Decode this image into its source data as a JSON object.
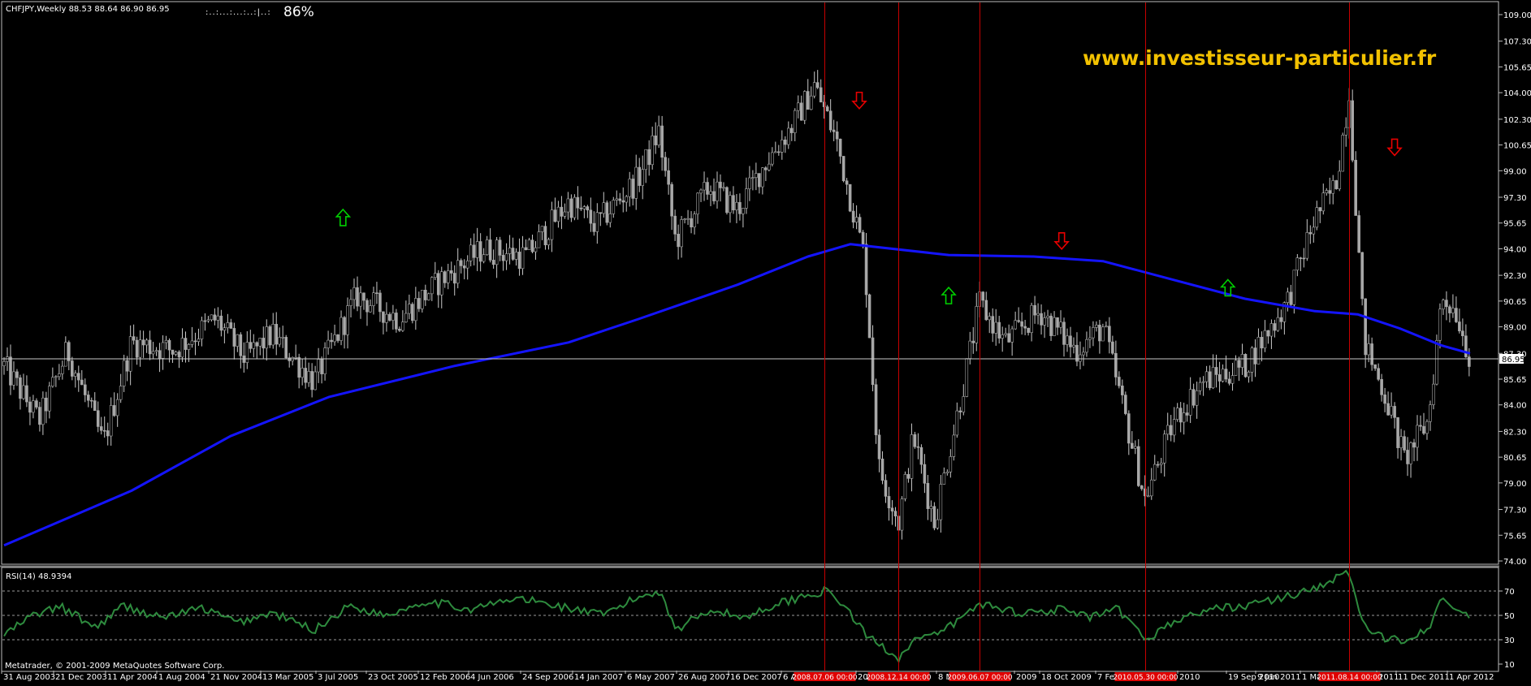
{
  "header": {
    "symbol_info": "CHFJPY,Weekly  88.53 88.64 86.90 86.95",
    "indicator_dots": ":..:...:...:..:|..:",
    "indicator_pct": "86%"
  },
  "watermark": "www.investisseur-particulier.fr",
  "rsi_panel": {
    "label": "RSI(14) 48.9394",
    "copyright": "Metatrader, © 2001-2009 MetaQuotes Software Corp."
  },
  "colors": {
    "background": "#000000",
    "candle_body": "#a8a8a8",
    "moving_average": "#1414ff",
    "vertical_markers": "#c80000",
    "rsi_line": "#2e8b3e",
    "up_arrow": "#00d000",
    "down_arrow": "#e80000",
    "watermark": "#f2c100"
  },
  "chart_data": [
    {
      "type": "candlestick",
      "symbol": "CHFJPY",
      "timeframe": "Weekly",
      "ylim": [
        74.0,
        109.0
      ],
      "y_ticks": [
        "109.00",
        "107.30",
        "105.65",
        "104.00",
        "102.30",
        "100.65",
        "99.00",
        "97.30",
        "95.65",
        "94.00",
        "92.30",
        "90.65",
        "89.00",
        "87.30",
        "85.65",
        "84.00",
        "82.30",
        "80.65",
        "79.00",
        "77.30",
        "75.65",
        "74.00"
      ],
      "current_price": "86.95",
      "x_tick_labels": [
        "31 Aug 2003",
        "21 Dec 2003",
        "11 Apr 2004",
        "1 Aug 2004",
        "21 Nov 2004",
        "13 Mar 2005",
        "3 Jul 2005",
        "23 Oct 2005",
        "12 Feb 2006",
        "4 Jun 2006",
        "24 Sep 2006",
        "14 Jan 2007",
        "6 May 2007",
        "26 Aug 2007",
        "16 Dec 2007",
        "6 A",
        "200",
        "8 M",
        "2009",
        "18 Oct 2009",
        "7 Feb",
        "2010",
        "19 Sep 2010",
        "9 Jan 2011",
        "1 Ma",
        "2011",
        "11 Dec 2011",
        "1 Apr 2012"
      ],
      "vertical_marker_labels": [
        "2008.07.06 00:00",
        "2008.12.14 00:00",
        "2009.06.07 00:00",
        "2010.05.30 00:00",
        "2011.08.14 00:00"
      ],
      "close_path": [
        [
          "2003-08-31",
          86.5
        ],
        [
          "2003-11-15",
          83.0
        ],
        [
          "2004-01-15",
          87.5
        ],
        [
          "2004-04-01",
          81.5
        ],
        [
          "2004-06-01",
          88.0
        ],
        [
          "2004-09-01",
          87.5
        ],
        [
          "2004-12-01",
          89.5
        ],
        [
          "2005-02-01",
          87.0
        ],
        [
          "2005-04-01",
          88.5
        ],
        [
          "2005-07-01",
          85.5
        ],
        [
          "2005-10-01",
          91.0
        ],
        [
          "2006-01-01",
          89.5
        ],
        [
          "2006-04-01",
          92.0
        ],
        [
          "2006-07-01",
          94.0
        ],
        [
          "2006-10-01",
          93.5
        ],
        [
          "2007-01-01",
          97.0
        ],
        [
          "2007-03-01",
          95.5
        ],
        [
          "2007-06-01",
          98.5
        ],
        [
          "2007-07-15",
          101.5
        ],
        [
          "2007-08-20",
          94.5
        ],
        [
          "2007-11-01",
          98.0
        ],
        [
          "2008-01-01",
          96.5
        ],
        [
          "2008-03-01",
          99.5
        ],
        [
          "2008-05-01",
          102.0
        ],
        [
          "2008-06-15",
          104.5
        ],
        [
          "2008-08-01",
          101.0
        ],
        [
          "2008-10-01",
          93.5
        ],
        [
          "2008-11-01",
          80.0
        ],
        [
          "2008-12-14",
          76.5
        ],
        [
          "2009-01-15",
          82.0
        ],
        [
          "2009-03-01",
          76.5
        ],
        [
          "2009-05-01",
          85.0
        ],
        [
          "2009-06-07",
          90.5
        ],
        [
          "2009-08-01",
          88.0
        ],
        [
          "2009-10-15",
          90.0
        ],
        [
          "2010-01-01",
          87.5
        ],
        [
          "2010-03-01",
          89.0
        ],
        [
          "2010-05-30",
          78.0
        ],
        [
          "2010-08-01",
          83.0
        ],
        [
          "2010-10-01",
          85.5
        ],
        [
          "2011-01-01",
          86.5
        ],
        [
          "2011-04-01",
          90.5
        ],
        [
          "2011-06-01",
          96.0
        ],
        [
          "2011-07-15",
          98.0
        ],
        [
          "2011-08-14",
          104.0
        ],
        [
          "2011-09-15",
          88.0
        ],
        [
          "2011-11-01",
          84.5
        ],
        [
          "2011-12-11",
          80.5
        ],
        [
          "2012-02-01",
          83.0
        ],
        [
          "2012-03-01",
          91.0
        ],
        [
          "2012-04-01",
          90.0
        ],
        [
          "2012-05-01",
          86.95
        ]
      ],
      "moving_average_path": [
        [
          "2003-08-31",
          75.0
        ],
        [
          "2004-06-01",
          78.5
        ],
        [
          "2005-01-01",
          82.0
        ],
        [
          "2005-08-01",
          84.5
        ],
        [
          "2006-05-01",
          86.5
        ],
        [
          "2007-01-01",
          88.0
        ],
        [
          "2007-06-01",
          89.5
        ],
        [
          "2008-01-01",
          91.7
        ],
        [
          "2008-06-01",
          93.5
        ],
        [
          "2008-09-01",
          94.3
        ],
        [
          "2009-04-01",
          93.6
        ],
        [
          "2009-10-01",
          93.5
        ],
        [
          "2010-03-01",
          93.2
        ],
        [
          "2010-08-01",
          92.0
        ],
        [
          "2011-01-01",
          90.8
        ],
        [
          "2011-06-01",
          90.0
        ],
        [
          "2011-09-01",
          89.8
        ],
        [
          "2011-12-01",
          88.9
        ],
        [
          "2012-03-01",
          87.8
        ],
        [
          "2012-05-01",
          87.3
        ]
      ],
      "signals": [
        {
          "date": "2005-09-01",
          "dir": "up",
          "price": 96.0
        },
        {
          "date": "2008-09-20",
          "dir": "down",
          "price": 103.5
        },
        {
          "date": "2009-04-01",
          "dir": "up",
          "price": 91.0
        },
        {
          "date": "2009-12-01",
          "dir": "down",
          "price": 94.5
        },
        {
          "date": "2010-11-25",
          "dir": "up",
          "price": 91.5
        },
        {
          "date": "2011-11-20",
          "dir": "down",
          "price": 100.5
        }
      ]
    },
    {
      "type": "line",
      "name": "RSI(14)",
      "last_value": "48.9394",
      "ylim": [
        10,
        90
      ],
      "y_ticks": [
        "70",
        "50",
        "30",
        "10"
      ],
      "levels": [
        70,
        50,
        30
      ],
      "path": [
        [
          "2003-08-31",
          34
        ],
        [
          "2003-11-01",
          50
        ],
        [
          "2004-01-01",
          57
        ],
        [
          "2004-03-15",
          40
        ],
        [
          "2004-05-15",
          58
        ],
        [
          "2004-08-01",
          48
        ],
        [
          "2004-11-01",
          56
        ],
        [
          "2005-01-15",
          44
        ],
        [
          "2005-04-01",
          52
        ],
        [
          "2005-07-01",
          38
        ],
        [
          "2005-09-15",
          58
        ],
        [
          "2005-12-01",
          50
        ],
        [
          "2006-03-01",
          62
        ],
        [
          "2006-06-01",
          55
        ],
        [
          "2006-09-15",
          64
        ],
        [
          "2007-01-01",
          56
        ],
        [
          "2007-03-15",
          50
        ],
        [
          "2007-06-01",
          65
        ],
        [
          "2007-07-20",
          70
        ],
        [
          "2007-08-20",
          38
        ],
        [
          "2007-11-01",
          55
        ],
        [
          "2008-01-15",
          48
        ],
        [
          "2008-03-15",
          58
        ],
        [
          "2008-05-15",
          65
        ],
        [
          "2008-07-06",
          70
        ],
        [
          "2008-08-15",
          60
        ],
        [
          "2008-10-01",
          35
        ],
        [
          "2008-12-14",
          15
        ],
        [
          "2009-01-15",
          30
        ],
        [
          "2009-03-01",
          33
        ],
        [
          "2009-05-01",
          48
        ],
        [
          "2009-06-07",
          60
        ],
        [
          "2009-09-01",
          52
        ],
        [
          "2009-12-01",
          55
        ],
        [
          "2010-02-01",
          48
        ],
        [
          "2010-04-01",
          55
        ],
        [
          "2010-05-30",
          30
        ],
        [
          "2010-08-01",
          45
        ],
        [
          "2010-10-15",
          55
        ],
        [
          "2011-01-01",
          58
        ],
        [
          "2011-04-01",
          65
        ],
        [
          "2011-06-15",
          75
        ],
        [
          "2011-08-14",
          85
        ],
        [
          "2011-09-15",
          40
        ],
        [
          "2011-10-20",
          32
        ],
        [
          "2011-12-11",
          30
        ],
        [
          "2012-02-01",
          40
        ],
        [
          "2012-03-01",
          62
        ],
        [
          "2012-04-01",
          55
        ],
        [
          "2012-05-01",
          49
        ]
      ]
    }
  ]
}
